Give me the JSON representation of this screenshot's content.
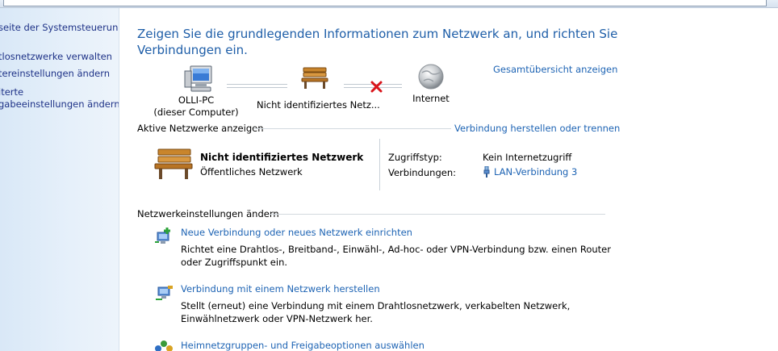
{
  "sidebar": {
    "items": [
      {
        "label": "seite der Systemsteuerung"
      },
      {
        "label": "tlosnetzwerke verwalten"
      },
      {
        "label": "tereinstellungen ändern"
      },
      {
        "label": "iterte"
      },
      {
        "label": "gabeeinstellungen ändern"
      }
    ]
  },
  "main": {
    "title": "Zeigen Sie die grundlegenden Informationen zum Netzwerk an, und richten Sie Verbindungen ein.",
    "full_map_link": "Gesamtübersicht anzeigen",
    "map": {
      "computer": {
        "name": "OLLI-PC",
        "sub": "(dieser Computer)",
        "icon": "computer-icon"
      },
      "network": {
        "name": "Nicht identifiziertes Netz...",
        "icon": "bench-icon"
      },
      "internet": {
        "name": "Internet",
        "icon": "globe-icon"
      },
      "break_icon": "red-x-icon"
    },
    "active_networks": {
      "heading": "Aktive Netzwerke anzeigen",
      "link": "Verbindung herstellen oder trennen",
      "network_name": "Nicht identifiziertes Netzwerk",
      "network_category": "Öffentliches Netzwerk",
      "access_type_label": "Zugriffstyp:",
      "access_type_value": "Kein Internetzugriff",
      "connections_label": "Verbindungen:",
      "connections_value": "LAN-Verbindung 3"
    },
    "change_settings": {
      "heading": "Netzwerkeinstellungen ändern",
      "tasks": [
        {
          "title": "Neue Verbindung oder neues Netzwerk einrichten",
          "desc": "Richtet eine Drahtlos-, Breitband-, Einwähl-, Ad-hoc- oder VPN-Verbindung bzw. einen Router oder Zugriffspunkt ein.",
          "icon": "new-connection-icon"
        },
        {
          "title": "Verbindung mit einem Netzwerk herstellen",
          "desc": "Stellt (erneut) eine Verbindung mit einem Drahtlosnetzwerk, verkabelten Netzwerk, Einwählnetzwerk oder VPN-Netzwerk her.",
          "icon": "connect-network-icon"
        },
        {
          "title": "Heimnetzgruppen- und Freigabeoptionen auswählen",
          "desc": "",
          "icon": "homegroup-icon"
        }
      ]
    }
  },
  "colors": {
    "link": "#1e64b4",
    "title": "#1e5ea8",
    "sidebar": "#dce9f7"
  }
}
